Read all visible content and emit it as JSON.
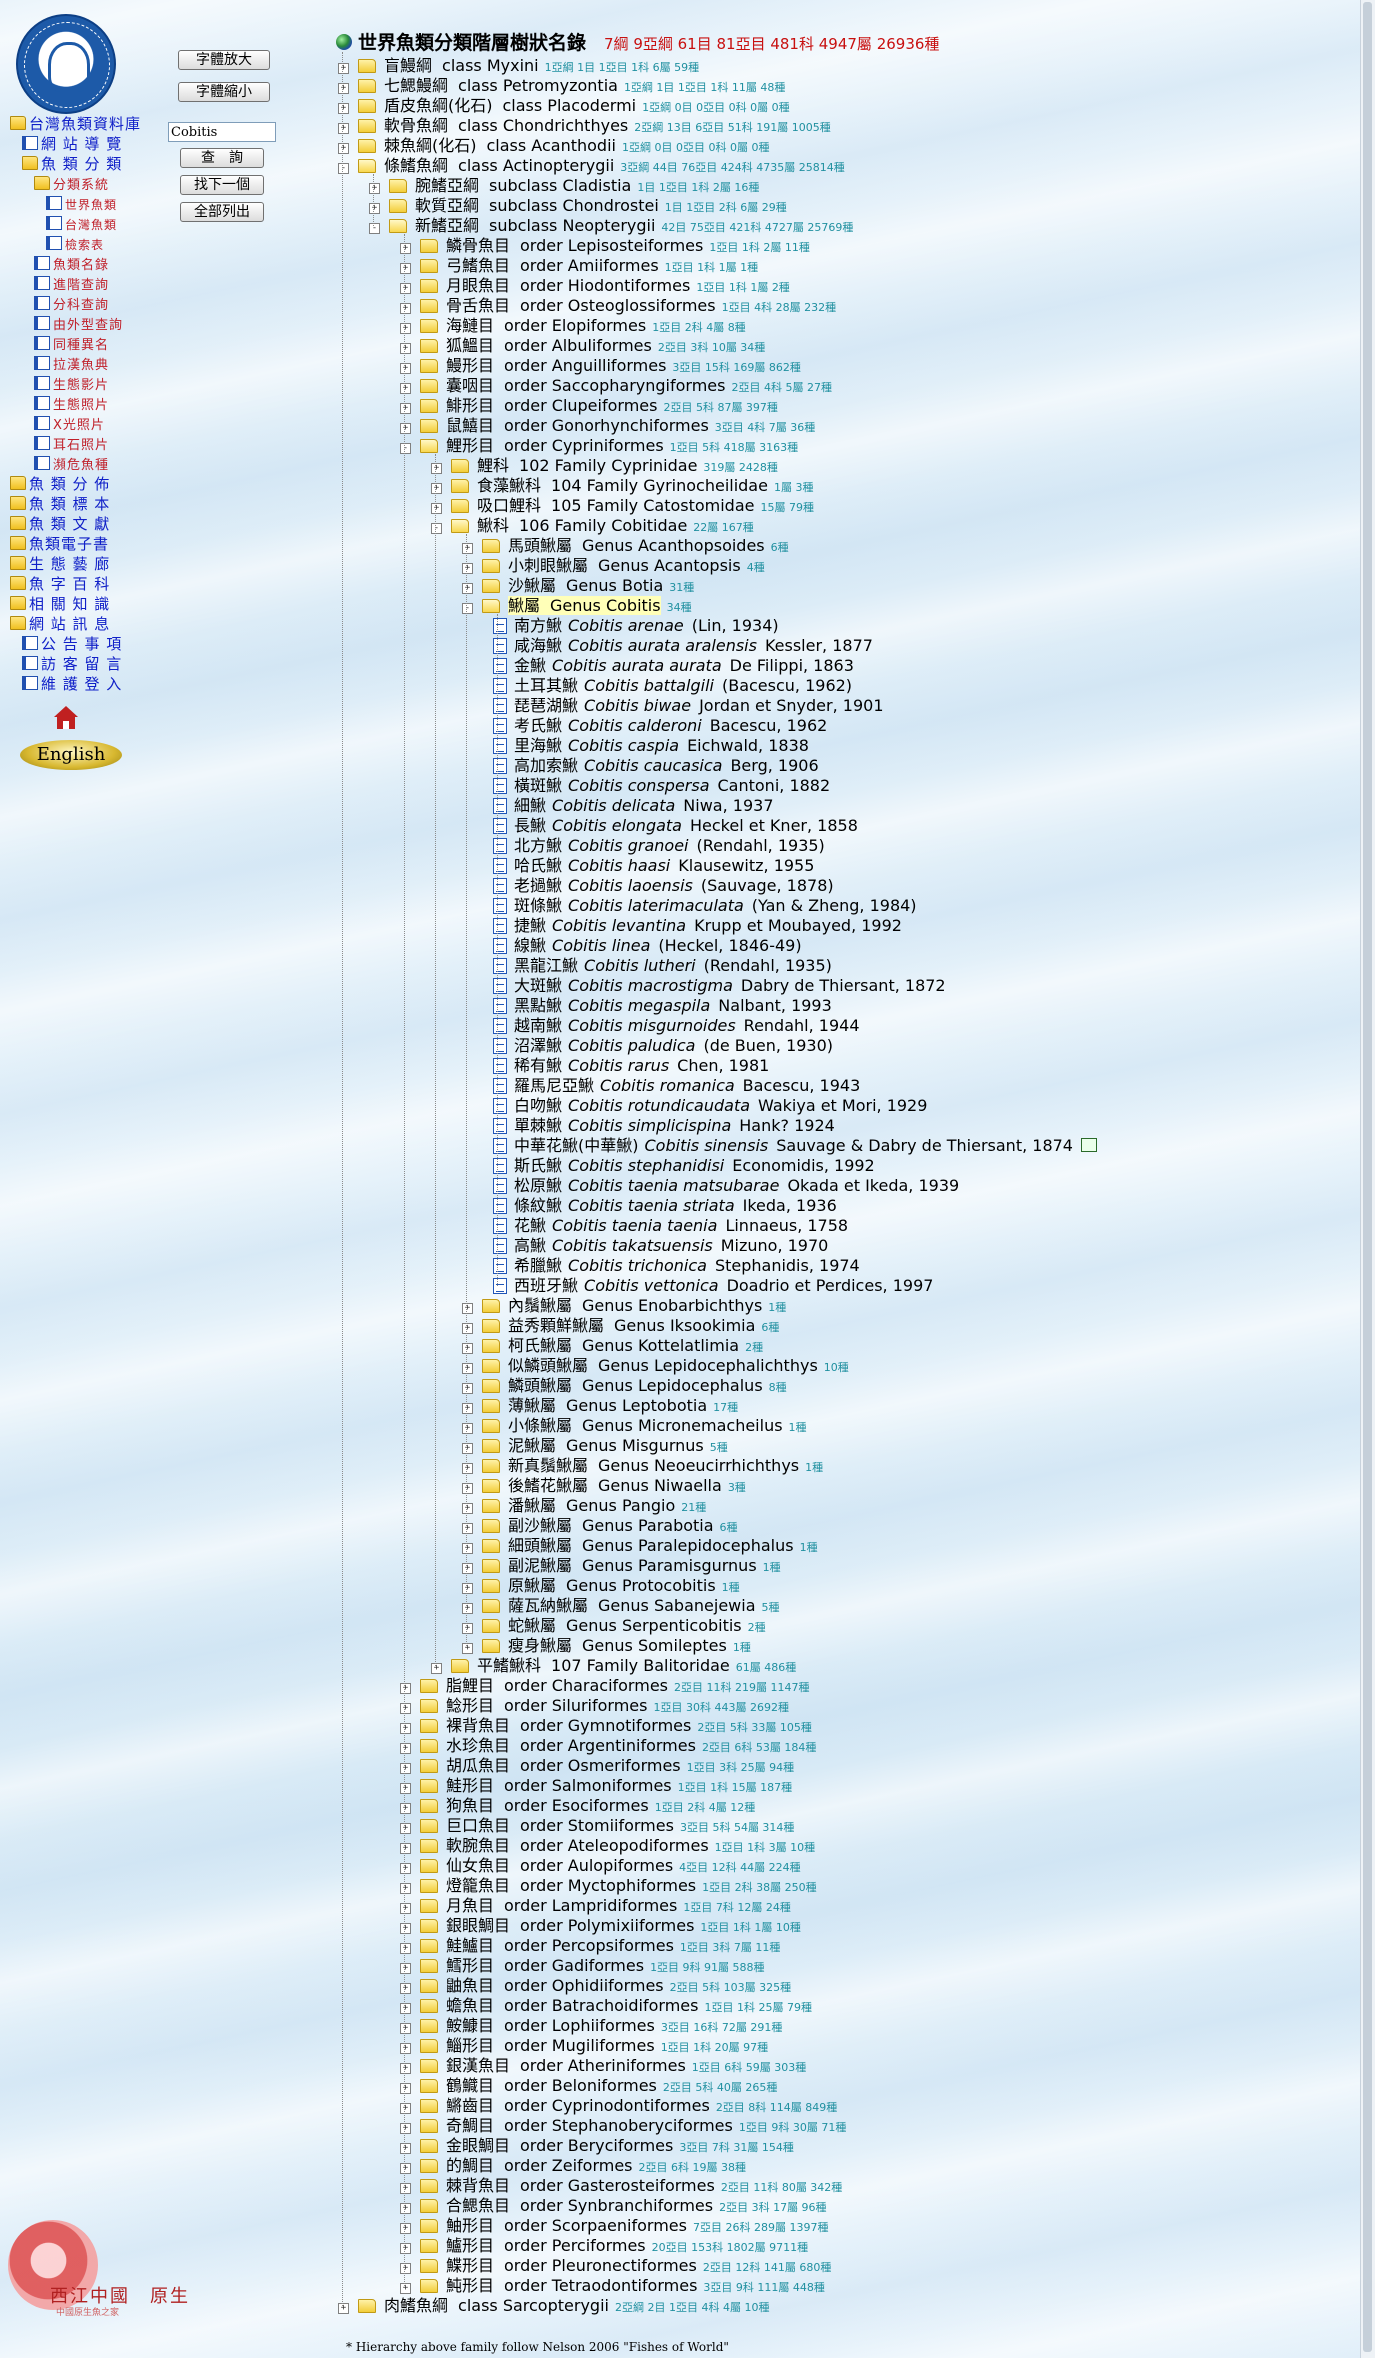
{
  "header": {
    "title": "世界魚類分類階層樹狀名錄",
    "stats": "7綱 9亞綱 61目 81亞目 481科 4947屬 26936種"
  },
  "left": {
    "font_larger": "字體放大",
    "font_smaller": "字體縮小",
    "search_value": "Cobitis",
    "search_button": "查　詢",
    "find_next": "找下一個",
    "list_all": "全部列出",
    "english": "English",
    "footer_logo": "西江中國　原生",
    "footer_logo_sub": "中國原生魚之家",
    "nav": [
      {
        "label": "台灣魚類資料庫",
        "level": 0,
        "icon": "folder",
        "color": "blue"
      },
      {
        "label": "網 站 導 覽",
        "level": 1,
        "icon": "doc",
        "color": "blue"
      },
      {
        "label": "魚 類 分 類",
        "level": 1,
        "icon": "folder",
        "color": "blue"
      },
      {
        "label": "分類系統",
        "level": 2,
        "icon": "folder",
        "color": "red"
      },
      {
        "label": "世界魚類",
        "level": 3,
        "icon": "doc",
        "color": "redsm"
      },
      {
        "label": "台灣魚類",
        "level": 3,
        "icon": "doc",
        "color": "redsm"
      },
      {
        "label": "檢索表",
        "level": 3,
        "icon": "doc",
        "color": "redsm"
      },
      {
        "label": "魚類名錄",
        "level": 2,
        "icon": "doc",
        "color": "red"
      },
      {
        "label": "進階查詢",
        "level": 2,
        "icon": "doc",
        "color": "red"
      },
      {
        "label": "分科查詢",
        "level": 2,
        "icon": "doc",
        "color": "red"
      },
      {
        "label": "由外型查詢",
        "level": 2,
        "icon": "doc",
        "color": "red"
      },
      {
        "label": "同種異名",
        "level": 2,
        "icon": "doc",
        "color": "red"
      },
      {
        "label": "拉漢魚典",
        "level": 2,
        "icon": "doc",
        "color": "red"
      },
      {
        "label": "生態影片",
        "level": 2,
        "icon": "doc",
        "color": "red"
      },
      {
        "label": "生態照片",
        "level": 2,
        "icon": "doc",
        "color": "red"
      },
      {
        "label": "X光照片",
        "level": 2,
        "icon": "doc",
        "color": "red"
      },
      {
        "label": "耳石照片",
        "level": 2,
        "icon": "doc",
        "color": "red"
      },
      {
        "label": "瀕危魚種",
        "level": 2,
        "icon": "doc",
        "color": "red"
      },
      {
        "label": "魚 類 分 佈",
        "level": 0,
        "icon": "folder",
        "color": "blue"
      },
      {
        "label": "魚 類 標 本",
        "level": 0,
        "icon": "folder",
        "color": "blue"
      },
      {
        "label": "魚 類 文 獻",
        "level": 0,
        "icon": "folder",
        "color": "blue"
      },
      {
        "label": "魚類電子書",
        "level": 0,
        "icon": "folder",
        "color": "blue"
      },
      {
        "label": "生 態 藝 廊",
        "level": 0,
        "icon": "folder",
        "color": "blue"
      },
      {
        "label": "魚 字 百 科",
        "level": 0,
        "icon": "folder",
        "color": "blue"
      },
      {
        "label": "相 關 知 識",
        "level": 0,
        "icon": "folder",
        "color": "blue"
      },
      {
        "label": "網 站 訊 息",
        "level": 0,
        "icon": "folder",
        "color": "blue"
      },
      {
        "label": "公 告 事 項",
        "level": 1,
        "icon": "doc",
        "color": "blue"
      },
      {
        "label": "訪 客 留 言",
        "level": 1,
        "icon": "doc",
        "color": "blue"
      },
      {
        "label": "維 護 登 入",
        "level": 1,
        "icon": "doc",
        "color": "blue"
      }
    ]
  },
  "tree": [
    {
      "l": 0,
      "t": "+",
      "zh": "盲鰻綱",
      "sci": "class Myxini",
      "c": "1亞綱 1目 1亞目 1科 6屬 59種"
    },
    {
      "l": 0,
      "t": "+",
      "zh": "七鰓鰻綱",
      "sci": "class Petromyzontia",
      "c": "1亞綱 1目 1亞目 1科 11屬 48種"
    },
    {
      "l": 0,
      "t": "+",
      "zh": "盾皮魚綱(化石)",
      "sci": "class Placodermi",
      "c": "1亞綱 0目 0亞目 0科 0屬 0種"
    },
    {
      "l": 0,
      "t": "+",
      "zh": "軟骨魚綱",
      "sci": "class Chondrichthyes",
      "c": "2亞綱 13目 6亞目 51科 191屬 1005種"
    },
    {
      "l": 0,
      "t": "+",
      "zh": "棘魚綱(化石)",
      "sci": "class Acanthodii",
      "c": "1亞綱 0目 0亞目 0科 0屬 0種"
    },
    {
      "l": 0,
      "t": "-",
      "zh": "條鰭魚綱",
      "sci": "class Actinopterygii",
      "c": "3亞綱 44目 76亞目 424科 4735屬 25814種",
      "open": true
    },
    {
      "l": 1,
      "t": "+",
      "zh": "腕鰭亞綱",
      "sci": "subclass Cladistia",
      "c": "1目 1亞目 1科 2屬 16種"
    },
    {
      "l": 1,
      "t": "+",
      "zh": "軟質亞綱",
      "sci": "subclass Chondrostei",
      "c": "1目 1亞目 2科 6屬 29種"
    },
    {
      "l": 1,
      "t": "-",
      "zh": "新鰭亞綱",
      "sci": "subclass Neopterygii",
      "c": "42目 75亞目 421科 4727屬 25769種",
      "open": true
    },
    {
      "l": 2,
      "t": "+",
      "zh": "鱗骨魚目",
      "sci": "order Lepisosteiformes",
      "c": "1亞目 1科 2屬 11種"
    },
    {
      "l": 2,
      "t": "+",
      "zh": "弓鰭魚目",
      "sci": "order Amiiformes",
      "c": "1亞目 1科 1屬 1種"
    },
    {
      "l": 2,
      "t": "+",
      "zh": "月眼魚目",
      "sci": "order Hiodontiformes",
      "c": "1亞目 1科 1屬 2種"
    },
    {
      "l": 2,
      "t": "+",
      "zh": "骨舌魚目",
      "sci": "order Osteoglossiformes",
      "c": "1亞目 4科 28屬 232種"
    },
    {
      "l": 2,
      "t": "+",
      "zh": "海鰱目",
      "sci": "order Elopiformes",
      "c": "1亞目 2科 4屬 8種"
    },
    {
      "l": 2,
      "t": "+",
      "zh": "狐鰮目",
      "sci": "order Albuliformes",
      "c": "2亞目 3科 10屬 34種"
    },
    {
      "l": 2,
      "t": "+",
      "zh": "鰻形目",
      "sci": "order Anguilliformes",
      "c": "3亞目 15科 169屬 862種"
    },
    {
      "l": 2,
      "t": "+",
      "zh": "囊咽目",
      "sci": "order Saccopharyngiformes",
      "c": "2亞目 4科 5屬 27種"
    },
    {
      "l": 2,
      "t": "+",
      "zh": "鯡形目",
      "sci": "order Clupeiformes",
      "c": "2亞目 5科 87屬 397種"
    },
    {
      "l": 2,
      "t": "+",
      "zh": "鼠鱚目",
      "sci": "order Gonorhynchiformes",
      "c": "3亞目 4科 7屬 36種"
    },
    {
      "l": 2,
      "t": "-",
      "zh": "鯉形目",
      "sci": "order Cypriniformes",
      "c": "1亞目 5科 418屬 3163種",
      "open": true
    },
    {
      "l": 3,
      "t": "+",
      "zh": "鯉科",
      "sci": "102 Family Cyprinidae",
      "c": "319屬 2428種"
    },
    {
      "l": 3,
      "t": "+",
      "zh": "食藻鰍科",
      "sci": "104 Family Gyrinocheilidae",
      "c": "1屬 3種"
    },
    {
      "l": 3,
      "t": "+",
      "zh": "吸口鯉科",
      "sci": "105 Family Catostomidae",
      "c": "15屬 79種"
    },
    {
      "l": 3,
      "t": "-",
      "zh": "鰍科",
      "sci": "106 Family Cobitidae",
      "c": "22屬 167種",
      "open": true
    },
    {
      "l": 4,
      "t": "+",
      "zh": "馬頭鰍屬",
      "sci": "Genus Acanthopsoides",
      "c": "6種"
    },
    {
      "l": 4,
      "t": "+",
      "zh": "小刺眼鰍屬",
      "sci": "Genus Acantopsis",
      "c": "4種"
    },
    {
      "l": 4,
      "t": "+",
      "zh": "沙鰍屬",
      "sci": "Genus Botia",
      "c": "31種"
    },
    {
      "l": 4,
      "t": "-",
      "zh": "鰍屬",
      "sci": "Genus Cobitis",
      "c": "34種",
      "open": true,
      "sel": true
    },
    {
      "l": 5,
      "sp": true,
      "zh": "南方鰍",
      "sci": "Cobitis arenae",
      "a": "(Lin, 1934)"
    },
    {
      "l": 5,
      "sp": true,
      "zh": "咸海鰍",
      "sci": "Cobitis aurata aralensis",
      "a": "Kessler, 1877"
    },
    {
      "l": 5,
      "sp": true,
      "zh": "金鰍",
      "sci": "Cobitis aurata aurata",
      "a": "De Filippi, 1863"
    },
    {
      "l": 5,
      "sp": true,
      "zh": "土耳其鰍",
      "sci": "Cobitis battalgili",
      "a": "(Bacescu, 1962)"
    },
    {
      "l": 5,
      "sp": true,
      "zh": "琵琶湖鰍",
      "sci": "Cobitis biwae",
      "a": "Jordan et Snyder, 1901"
    },
    {
      "l": 5,
      "sp": true,
      "zh": "考氏鰍",
      "sci": "Cobitis calderoni",
      "a": "Bacescu, 1962"
    },
    {
      "l": 5,
      "sp": true,
      "zh": "里海鰍",
      "sci": "Cobitis caspia",
      "a": "Eichwald, 1838"
    },
    {
      "l": 5,
      "sp": true,
      "zh": "高加索鰍",
      "sci": "Cobitis caucasica",
      "a": "Berg, 1906"
    },
    {
      "l": 5,
      "sp": true,
      "zh": "橫斑鰍",
      "sci": "Cobitis conspersa",
      "a": "Cantoni, 1882"
    },
    {
      "l": 5,
      "sp": true,
      "zh": "細鰍",
      "sci": "Cobitis delicata",
      "a": "Niwa, 1937"
    },
    {
      "l": 5,
      "sp": true,
      "zh": "長鰍",
      "sci": "Cobitis elongata",
      "a": "Heckel et Kner, 1858"
    },
    {
      "l": 5,
      "sp": true,
      "zh": "北方鰍",
      "sci": "Cobitis granoei",
      "a": "(Rendahl, 1935)"
    },
    {
      "l": 5,
      "sp": true,
      "zh": "哈氏鰍",
      "sci": "Cobitis haasi",
      "a": "Klausewitz, 1955"
    },
    {
      "l": 5,
      "sp": true,
      "zh": "老撾鰍",
      "sci": "Cobitis laoensis",
      "a": "(Sauvage, 1878)"
    },
    {
      "l": 5,
      "sp": true,
      "zh": "斑條鰍",
      "sci": "Cobitis laterimaculata",
      "a": "(Yan & Zheng, 1984)"
    },
    {
      "l": 5,
      "sp": true,
      "zh": "捷鰍",
      "sci": "Cobitis levantina",
      "a": "Krupp et Moubayed, 1992"
    },
    {
      "l": 5,
      "sp": true,
      "zh": "線鰍",
      "sci": "Cobitis linea",
      "a": "(Heckel, 1846-49)"
    },
    {
      "l": 5,
      "sp": true,
      "zh": "黑龍江鰍",
      "sci": "Cobitis lutheri",
      "a": "(Rendahl, 1935)"
    },
    {
      "l": 5,
      "sp": true,
      "zh": "大斑鰍",
      "sci": "Cobitis macrostigma",
      "a": "Dabry de Thiersant, 1872"
    },
    {
      "l": 5,
      "sp": true,
      "zh": "黑點鰍",
      "sci": "Cobitis megaspila",
      "a": "Nalbant, 1993"
    },
    {
      "l": 5,
      "sp": true,
      "zh": "越南鰍",
      "sci": "Cobitis misgurnoides",
      "a": "Rendahl, 1944"
    },
    {
      "l": 5,
      "sp": true,
      "zh": "沼澤鰍",
      "sci": "Cobitis paludica",
      "a": "(de Buen, 1930)"
    },
    {
      "l": 5,
      "sp": true,
      "zh": "稀有鰍",
      "sci": "Cobitis rarus",
      "a": "Chen, 1981"
    },
    {
      "l": 5,
      "sp": true,
      "zh": "羅馬尼亞鰍",
      "sci": "Cobitis romanica",
      "a": "Bacescu, 1943"
    },
    {
      "l": 5,
      "sp": true,
      "zh": "白吻鰍",
      "sci": "Cobitis rotundicaudata",
      "a": "Wakiya et Mori, 1929"
    },
    {
      "l": 5,
      "sp": true,
      "zh": "單棘鰍",
      "sci": "Cobitis simplicispina",
      "a": "Hank? 1924"
    },
    {
      "l": 5,
      "sp": true,
      "zh": "中華花鰍(中華鰍)",
      "sci": "Cobitis sinensis",
      "a": "Sauvage & Dabry de Thiersant, 1874",
      "edit": true
    },
    {
      "l": 5,
      "sp": true,
      "zh": "斯氏鰍",
      "sci": "Cobitis stephanidisi",
      "a": "Economidis, 1992"
    },
    {
      "l": 5,
      "sp": true,
      "zh": "松原鰍",
      "sci": "Cobitis taenia matsubarae",
      "a": "Okada et Ikeda, 1939"
    },
    {
      "l": 5,
      "sp": true,
      "zh": "條紋鰍",
      "sci": "Cobitis taenia striata",
      "a": "Ikeda, 1936"
    },
    {
      "l": 5,
      "sp": true,
      "zh": "花鰍",
      "sci": "Cobitis taenia taenia",
      "a": "Linnaeus, 1758"
    },
    {
      "l": 5,
      "sp": true,
      "zh": "高鰍",
      "sci": "Cobitis takatsuensis",
      "a": "Mizuno, 1970"
    },
    {
      "l": 5,
      "sp": true,
      "zh": "希臘鰍",
      "sci": "Cobitis trichonica",
      "a": "Stephanidis, 1974"
    },
    {
      "l": 5,
      "sp": true,
      "zh": "西班牙鰍",
      "sci": "Cobitis vettonica",
      "a": "Doadrio et Perdices, 1997"
    },
    {
      "l": 4,
      "t": "+",
      "zh": "內鬚鰍屬",
      "sci": "Genus Enobarbichthys",
      "c": "1種"
    },
    {
      "l": 4,
      "t": "+",
      "zh": "益秀顆鮮鰍屬",
      "sci": "Genus Iksookimia",
      "c": "6種"
    },
    {
      "l": 4,
      "t": "+",
      "zh": "柯氏鰍屬",
      "sci": "Genus Kottelatlimia",
      "c": "2種"
    },
    {
      "l": 4,
      "t": "+",
      "zh": "似鱗頭鰍屬",
      "sci": "Genus Lepidocephalichthys",
      "c": "10種"
    },
    {
      "l": 4,
      "t": "+",
      "zh": "鱗頭鰍屬",
      "sci": "Genus Lepidocephalus",
      "c": "8種"
    },
    {
      "l": 4,
      "t": "+",
      "zh": "薄鰍屬",
      "sci": "Genus Leptobotia",
      "c": "17種"
    },
    {
      "l": 4,
      "t": "+",
      "zh": "小條鰍屬",
      "sci": "Genus Micronemacheilus",
      "c": "1種"
    },
    {
      "l": 4,
      "t": "+",
      "zh": "泥鰍屬",
      "sci": "Genus Misgurnus",
      "c": "5種"
    },
    {
      "l": 4,
      "t": "+",
      "zh": "新真鬚鰍屬",
      "sci": "Genus Neoeucirrhichthys",
      "c": "1種"
    },
    {
      "l": 4,
      "t": "+",
      "zh": "後鰭花鰍屬",
      "sci": "Genus Niwaella",
      "c": "3種"
    },
    {
      "l": 4,
      "t": "+",
      "zh": "潘鰍屬",
      "sci": "Genus Pangio",
      "c": "21種"
    },
    {
      "l": 4,
      "t": "+",
      "zh": "副沙鰍屬",
      "sci": "Genus Parabotia",
      "c": "6種"
    },
    {
      "l": 4,
      "t": "+",
      "zh": "細頭鰍屬",
      "sci": "Genus Paralepidocephalus",
      "c": "1種"
    },
    {
      "l": 4,
      "t": "+",
      "zh": "副泥鰍屬",
      "sci": "Genus Paramisgurnus",
      "c": "1種"
    },
    {
      "l": 4,
      "t": "+",
      "zh": "原鰍屬",
      "sci": "Genus Protocobitis",
      "c": "1種"
    },
    {
      "l": 4,
      "t": "+",
      "zh": "薩瓦納鰍屬",
      "sci": "Genus Sabanejewia",
      "c": "5種"
    },
    {
      "l": 4,
      "t": "+",
      "zh": "蛇鰍屬",
      "sci": "Genus Serpenticobitis",
      "c": "2種"
    },
    {
      "l": 4,
      "t": "+",
      "zh": "瘦身鰍屬",
      "sci": "Genus Somileptes",
      "c": "1種"
    },
    {
      "l": 3,
      "t": "+",
      "zh": "平鰭鰍科",
      "sci": "107 Family Balitoridae",
      "c": "61屬 486種"
    },
    {
      "l": 2,
      "t": "+",
      "zh": "脂鯉目",
      "sci": "order Characiformes",
      "c": "2亞目 11科 219屬 1147種"
    },
    {
      "l": 2,
      "t": "+",
      "zh": "鯰形目",
      "sci": "order Siluriformes",
      "c": "1亞目 30科 443屬 2692種"
    },
    {
      "l": 2,
      "t": "+",
      "zh": "裸背魚目",
      "sci": "order Gymnotiformes",
      "c": "2亞目 5科 33屬 105種"
    },
    {
      "l": 2,
      "t": "+",
      "zh": "水珍魚目",
      "sci": "order Argentiniformes",
      "c": "2亞目 6科 53屬 184種"
    },
    {
      "l": 2,
      "t": "+",
      "zh": "胡瓜魚目",
      "sci": "order Osmeriformes",
      "c": "1亞目 3科 25屬 94種"
    },
    {
      "l": 2,
      "t": "+",
      "zh": "鮭形目",
      "sci": "order Salmoniformes",
      "c": "1亞目 1科 15屬 187種"
    },
    {
      "l": 2,
      "t": "+",
      "zh": "狗魚目",
      "sci": "order Esociformes",
      "c": "1亞目 2科 4屬 12種"
    },
    {
      "l": 2,
      "t": "+",
      "zh": "巨口魚目",
      "sci": "order Stomiiformes",
      "c": "3亞目 5科 54屬 314種"
    },
    {
      "l": 2,
      "t": "+",
      "zh": "軟腕魚目",
      "sci": "order Ateleopodiformes",
      "c": "1亞目 1科 3屬 10種"
    },
    {
      "l": 2,
      "t": "+",
      "zh": "仙女魚目",
      "sci": "order Aulopiformes",
      "c": "4亞目 12科 44屬 224種"
    },
    {
      "l": 2,
      "t": "+",
      "zh": "燈籠魚目",
      "sci": "order Myctophiformes",
      "c": "1亞目 2科 38屬 250種"
    },
    {
      "l": 2,
      "t": "+",
      "zh": "月魚目",
      "sci": "order Lampridiformes",
      "c": "1亞目 7科 12屬 24種"
    },
    {
      "l": 2,
      "t": "+",
      "zh": "銀眼鯛目",
      "sci": "order Polymixiiformes",
      "c": "1亞目 1科 1屬 10種"
    },
    {
      "l": 2,
      "t": "+",
      "zh": "鮭鱸目",
      "sci": "order Percopsiformes",
      "c": "1亞目 3科 7屬 11種"
    },
    {
      "l": 2,
      "t": "+",
      "zh": "鱈形目",
      "sci": "order Gadiformes",
      "c": "1亞目 9科 91屬 588種"
    },
    {
      "l": 2,
      "t": "+",
      "zh": "鼬魚目",
      "sci": "order Ophidiiformes",
      "c": "2亞目 5科 103屬 325種"
    },
    {
      "l": 2,
      "t": "+",
      "zh": "蟾魚目",
      "sci": "order Batrachoidiformes",
      "c": "1亞目 1科 25屬 79種"
    },
    {
      "l": 2,
      "t": "+",
      "zh": "鮟鱇目",
      "sci": "order Lophiiformes",
      "c": "3亞目 16科 72屬 291種"
    },
    {
      "l": 2,
      "t": "+",
      "zh": "鯔形目",
      "sci": "order Mugiliformes",
      "c": "1亞目 1科 20屬 97種"
    },
    {
      "l": 2,
      "t": "+",
      "zh": "銀漢魚目",
      "sci": "order Atheriniformes",
      "c": "1亞目 6科 59屬 303種"
    },
    {
      "l": 2,
      "t": "+",
      "zh": "鶴鱵目",
      "sci": "order Beloniformes",
      "c": "2亞目 5科 40屬 265種"
    },
    {
      "l": 2,
      "t": "+",
      "zh": "鱂齒目",
      "sci": "order Cyprinodontiformes",
      "c": "2亞目 8科 114屬 849種"
    },
    {
      "l": 2,
      "t": "+",
      "zh": "奇鯛目",
      "sci": "order Stephanoberyciformes",
      "c": "1亞目 9科 30屬 71種"
    },
    {
      "l": 2,
      "t": "+",
      "zh": "金眼鯛目",
      "sci": "order Beryciformes",
      "c": "3亞目 7科 31屬 154種"
    },
    {
      "l": 2,
      "t": "+",
      "zh": "的鯛目",
      "sci": "order Zeiformes",
      "c": "2亞目 6科 19屬 38種"
    },
    {
      "l": 2,
      "t": "+",
      "zh": "棘背魚目",
      "sci": "order Gasterosteiformes",
      "c": "2亞目 11科 80屬 342種"
    },
    {
      "l": 2,
      "t": "+",
      "zh": "合鰓魚目",
      "sci": "order Synbranchiformes",
      "c": "2亞目 3科 17屬 96種"
    },
    {
      "l": 2,
      "t": "+",
      "zh": "鮋形目",
      "sci": "order Scorpaeniformes",
      "c": "7亞目 26科 289屬 1397種"
    },
    {
      "l": 2,
      "t": "+",
      "zh": "鱸形目",
      "sci": "order Perciformes",
      "c": "20亞目 153科 1802屬 9711種"
    },
    {
      "l": 2,
      "t": "+",
      "zh": "鰈形目",
      "sci": "order Pleuronectiformes",
      "c": "2亞目 12科 141屬 680種"
    },
    {
      "l": 2,
      "t": "+",
      "zh": "魨形目",
      "sci": "order Tetraodontiformes",
      "c": "3亞目 9科 111屬 448種"
    },
    {
      "l": 0,
      "t": "+",
      "zh": "肉鰭魚綱",
      "sci": "class Sarcopterygii",
      "c": "2亞綱 2目 1亞目 4科 4屬 10種"
    }
  ],
  "footnote": "* Hierarchy above family follow Nelson 2006 \"Fishes of World\""
}
